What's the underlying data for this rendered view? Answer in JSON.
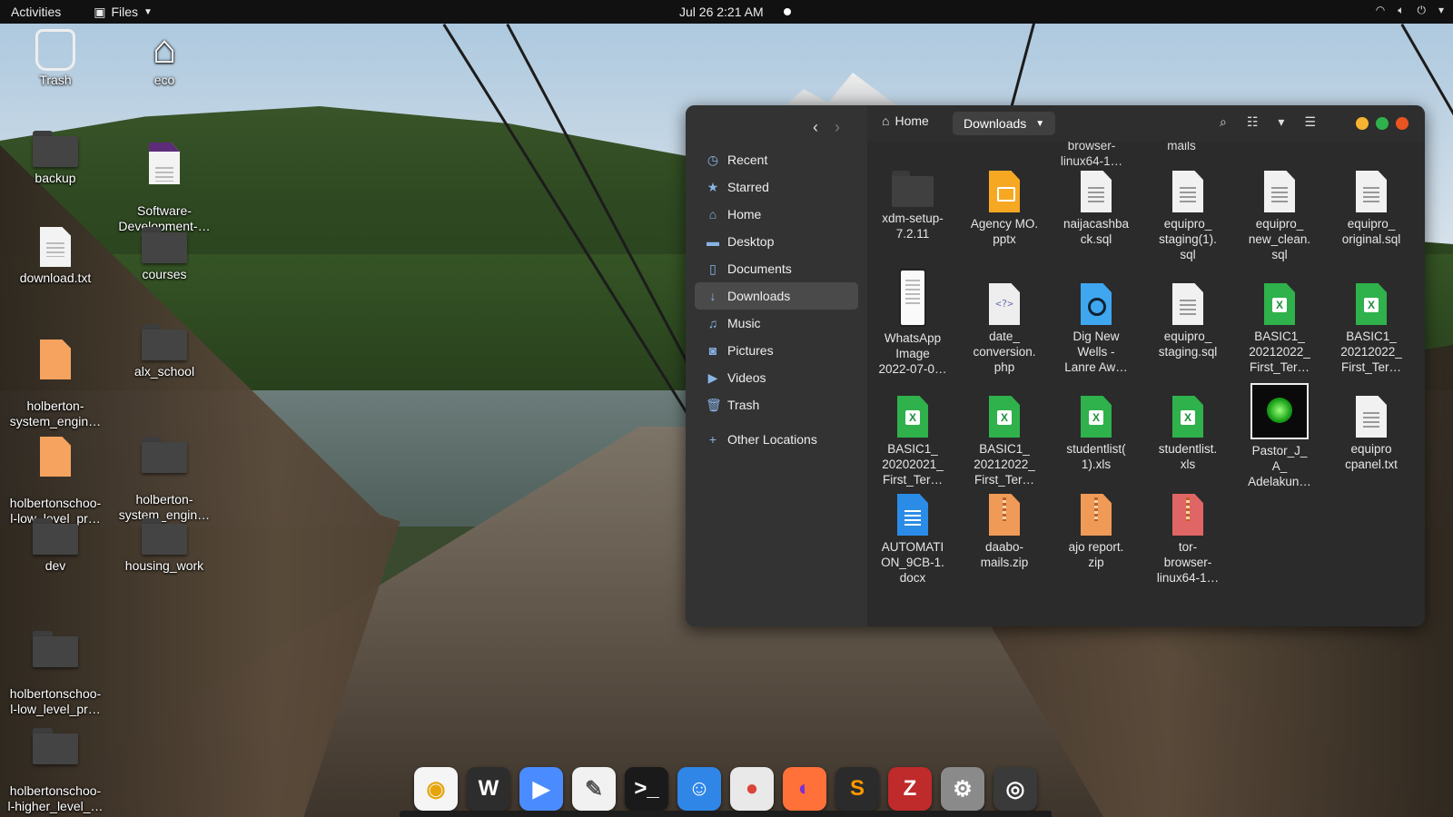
{
  "topbar": {
    "activities": "Activities",
    "app_menu": "Files",
    "clock": "Jul 26  2:21 AM"
  },
  "desktop": {
    "icons": [
      {
        "label": "Trash",
        "kind": "trash-icon"
      },
      {
        "label": "eco",
        "kind": "home-icon"
      },
      {
        "label": "backup",
        "kind": "folder-icon"
      },
      {
        "label": "Software-\nDevelopment-…",
        "kind": "document-icon"
      },
      {
        "label": "download.txt",
        "kind": "text-file-icon"
      },
      {
        "label": "courses",
        "kind": "folder-icon"
      },
      {
        "label": "holberton-\nsystem_engin…",
        "kind": "archive-icon"
      },
      {
        "label": "alx_school",
        "kind": "folder-icon"
      },
      {
        "label": "holbertonschoo-\nl-low_level_pr…",
        "kind": "archive-icon"
      },
      {
        "label": "holberton-\nsystem_engin…",
        "kind": "folder-icon"
      },
      {
        "label": "dev",
        "kind": "folder-icon"
      },
      {
        "label": "housing_work",
        "kind": "folder-icon"
      },
      {
        "label": "holbertonschoo-\nl-low_level_pr…",
        "kind": "folder-icon"
      },
      {
        "label": "holbertonschoo-\nl-higher_level_…",
        "kind": "folder-icon"
      }
    ]
  },
  "window": {
    "sidebar": [
      {
        "label": "Recent",
        "icon": "clock-icon"
      },
      {
        "label": "Starred",
        "icon": "star-icon"
      },
      {
        "label": "Home",
        "icon": "home-icon"
      },
      {
        "label": "Desktop",
        "icon": "folder-icon"
      },
      {
        "label": "Documents",
        "icon": "document-icon"
      },
      {
        "label": "Downloads",
        "icon": "download-icon",
        "active": true
      },
      {
        "label": "Music",
        "icon": "music-icon"
      },
      {
        "label": "Pictures",
        "icon": "camera-icon"
      },
      {
        "label": "Videos",
        "icon": "video-icon"
      },
      {
        "label": "Trash",
        "icon": "trash-icon"
      },
      {
        "label": "Other Locations",
        "icon": "plus-icon"
      }
    ],
    "breadcrumb_home": "Home",
    "breadcrumb_current": "Downloads",
    "cut_row": [
      "browser-\nlinux64-1…",
      "mails"
    ],
    "files": [
      {
        "name": "xdm-setup-\n7.2.11",
        "type": "folder"
      },
      {
        "name": "Agency MO.\npptx",
        "type": "pptx"
      },
      {
        "name": "naijacashba\nck.sql",
        "type": "text"
      },
      {
        "name": "equipro_\nstaging(1).\nsql",
        "type": "text"
      },
      {
        "name": "equipro_\nnew_clean.\nsql",
        "type": "text"
      },
      {
        "name": "equipro_\noriginal.sql",
        "type": "text"
      },
      {
        "name": "WhatsApp\nImage\n2022-07-0…",
        "type": "image"
      },
      {
        "name": "date_\nconversion.\nphp",
        "type": "php"
      },
      {
        "name": "Dig New\nWells -\nLanre Aw…",
        "type": "video"
      },
      {
        "name": "equipro_\nstaging.sql",
        "type": "text"
      },
      {
        "name": "BASIC1_\n20212022_\nFirst_Ter…",
        "type": "xls"
      },
      {
        "name": "BASIC1_\n20212022_\nFirst_Ter…",
        "type": "xls"
      },
      {
        "name": "BASIC1_\n20202021_\nFirst_Ter…",
        "type": "xls"
      },
      {
        "name": "BASIC1_\n20212022_\nFirst_Ter…",
        "type": "xls"
      },
      {
        "name": "studentlist(\n1).xls",
        "type": "xls"
      },
      {
        "name": "studentlist.\nxls",
        "type": "xls"
      },
      {
        "name": "Pastor_J_\nA_\nAdelakun…",
        "type": "thumb"
      },
      {
        "name": "equipro\ncpanel.txt",
        "type": "text"
      },
      {
        "name": "AUTOMATI\nON_9CB-1.\ndocx",
        "type": "docx"
      },
      {
        "name": "daabo-\nmails.zip",
        "type": "zip"
      },
      {
        "name": "ajo report.\nzip",
        "type": "zip"
      },
      {
        "name": "tor-\nbrowser-\nlinux64-1…",
        "type": "zip-red"
      }
    ]
  },
  "dock": [
    {
      "name": "rhythmbox-icon",
      "glyph": "◉",
      "bg": "#f5f5f5",
      "fg": "#e5a50a"
    },
    {
      "name": "wps-writer-icon",
      "glyph": "W",
      "bg": "#2d2d2d",
      "fg": "#ffffff"
    },
    {
      "name": "zoom-icon",
      "glyph": "▶",
      "bg": "#4a8cff",
      "fg": "#ffffff"
    },
    {
      "name": "text-editor-icon",
      "glyph": "✎",
      "bg": "#f1f1f1",
      "fg": "#555555"
    },
    {
      "name": "terminal-icon",
      "glyph": ">_",
      "bg": "#1a1a1a",
      "fg": "#ffffff"
    },
    {
      "name": "finder-icon",
      "glyph": "☺",
      "bg": "#2f86e6",
      "fg": "#ffffff"
    },
    {
      "name": "chrome-icon",
      "glyph": "●",
      "bg": "#e9e9e9",
      "fg": "#db4437"
    },
    {
      "name": "firefox-icon",
      "glyph": "◐",
      "bg": "#ff7139",
      "fg": "#7b2fd6"
    },
    {
      "name": "sublime-icon",
      "glyph": "S",
      "bg": "#2b2b2b",
      "fg": "#ff9800"
    },
    {
      "name": "filezilla-icon",
      "glyph": "Z",
      "bg": "#bf2a2a",
      "fg": "#ffffff"
    },
    {
      "name": "settings-icon",
      "glyph": "⚙",
      "bg": "#8a8a8a",
      "fg": "#ffffff"
    },
    {
      "name": "screenshot-icon",
      "glyph": "◎",
      "bg": "#3a3a3a",
      "fg": "#ffffff"
    }
  ],
  "colors": {
    "close": "#e95420",
    "minimize": "#f6b431",
    "maximize": "#2fb14b"
  }
}
